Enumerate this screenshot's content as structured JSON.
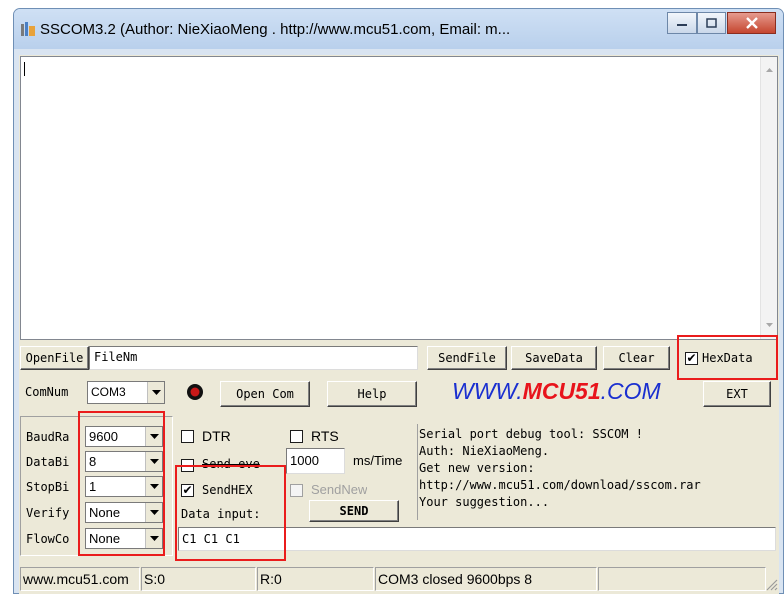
{
  "window": {
    "title": "SSCOM3.2 (Author: NieXiaoMeng . http://www.mcu51.com, Email: m..."
  },
  "toolbar": {
    "openfile": "OpenFile",
    "filename": "FileNm",
    "sendfile": "SendFile",
    "savedata": "SaveData",
    "clear": "Clear",
    "hexdata": "HexData",
    "hexdata_checked": true
  },
  "row2": {
    "comnum_label": "ComNum",
    "comnum_value": "COM3",
    "open_com": "Open Com",
    "help": "Help",
    "logo_www": "WWW.",
    "logo_mcu": "MCU51",
    "logo_com": ".COM",
    "ext": "EXT"
  },
  "settings": {
    "baud_label": "BaudRa",
    "baud_value": "9600",
    "databits_label": "DataBi",
    "databits_value": "8",
    "stopbits_label": "StopBi",
    "stopbits_value": "1",
    "verify_label": "Verify",
    "verify_value": "None",
    "flow_label": "FlowCo",
    "flow_value": "None"
  },
  "signals": {
    "dtr": "DTR",
    "rts": "RTS",
    "send_every": "Send eve",
    "interval": "1000",
    "interval_unit": "ms/Time",
    "sendhex": "SendHEX",
    "sendhex_checked": true,
    "sendnew": "SendNew",
    "data_input_label": "Data input:",
    "send": "SEND",
    "data_input_value": "C1 C1 C1"
  },
  "info": {
    "line1": "Serial port debug tool: SSCOM !",
    "line2": "Auth: NieXiaoMeng.",
    "line3": "Get new version:",
    "line4": "http://www.mcu51.com/download/sscom.rar",
    "line5": "Your suggestion..."
  },
  "statusbar": {
    "url": "www.mcu51.com",
    "sent": "S:0",
    "received": "R:0",
    "port_status": "COM3 closed  9600bps  8"
  },
  "colors": {
    "logo_blue": "#1a2fd0",
    "logo_red": "#e8141c",
    "highlight_red": "#ea1c1c"
  }
}
